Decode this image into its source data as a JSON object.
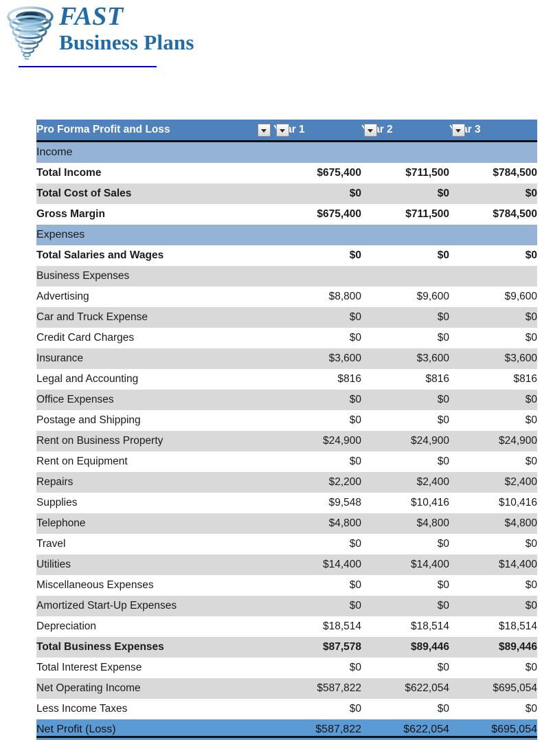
{
  "brand": {
    "line1": "FAST",
    "line2": "Business Plans",
    "logo_icon": "tornado-icon",
    "rule_color": "#0000CC",
    "text_color": "#1F6CA8"
  },
  "table": {
    "columns": [
      {
        "label": "Pro Forma Profit and Loss",
        "filter_icon": "chevron-down-icon"
      },
      {
        "label": "Year 1",
        "filter_icon": "chevron-down-icon"
      },
      {
        "label": "Year 2",
        "filter_icon": "chevron-down-icon"
      },
      {
        "label": "Year 3",
        "filter_icon": "chevron-down-icon"
      }
    ],
    "colors": {
      "header": "#4F81BD",
      "section": "#95B3D7",
      "band_gray": "#D9D9D9",
      "band_white": "#FFFFFF",
      "total": "#5B9BD5"
    },
    "rows": [
      {
        "label": "Income",
        "year1": "",
        "year2": "",
        "year3": "",
        "style": "section",
        "indent": 0,
        "bold": false
      },
      {
        "label": "Total Income",
        "year1": "$675,400",
        "year2": "$711,500",
        "year3": "$784,500",
        "style": "band-white",
        "indent": 1,
        "bold": true
      },
      {
        "label": "Total Cost of Sales",
        "year1": "$0",
        "year2": "$0",
        "year3": "$0",
        "style": "band-gray",
        "indent": 1,
        "bold": true
      },
      {
        "label": "Gross Margin",
        "year1": "$675,400",
        "year2": "$711,500",
        "year3": "$784,500",
        "style": "band-white",
        "indent": 1,
        "bold": true
      },
      {
        "label": "Expenses",
        "year1": "",
        "year2": "",
        "year3": "",
        "style": "section",
        "indent": 0,
        "bold": false
      },
      {
        "label": "Total Salaries and Wages",
        "year1": "$0",
        "year2": "$0",
        "year3": "$0",
        "style": "band-white",
        "indent": 1,
        "bold": true
      },
      {
        "label": "Business Expenses",
        "year1": "",
        "year2": "",
        "year3": "",
        "style": "band-gray",
        "indent": 1,
        "bold": false
      },
      {
        "label": "Advertising",
        "year1": "$8,800",
        "year2": "$9,600",
        "year3": "$9,600",
        "style": "band-white",
        "indent": 2,
        "bold": false
      },
      {
        "label": "Car and Truck Expense",
        "year1": "$0",
        "year2": "$0",
        "year3": "$0",
        "style": "band-gray",
        "indent": 2,
        "bold": false
      },
      {
        "label": "Credit Card Charges",
        "year1": "$0",
        "year2": "$0",
        "year3": "$0",
        "style": "band-white",
        "indent": 2,
        "bold": false
      },
      {
        "label": "Insurance",
        "year1": "$3,600",
        "year2": "$3,600",
        "year3": "$3,600",
        "style": "band-gray",
        "indent": 2,
        "bold": false
      },
      {
        "label": "Legal and Accounting",
        "year1": "$816",
        "year2": "$816",
        "year3": "$816",
        "style": "band-white",
        "indent": 2,
        "bold": false
      },
      {
        "label": "Office Expenses",
        "year1": "$0",
        "year2": "$0",
        "year3": "$0",
        "style": "band-gray",
        "indent": 2,
        "bold": false
      },
      {
        "label": "Postage and Shipping",
        "year1": "$0",
        "year2": "$0",
        "year3": "$0",
        "style": "band-white",
        "indent": 2,
        "bold": false
      },
      {
        "label": "Rent on Business Property",
        "year1": "$24,900",
        "year2": "$24,900",
        "year3": "$24,900",
        "style": "band-gray",
        "indent": 2,
        "bold": false
      },
      {
        "label": "Rent on Equipment",
        "year1": "$0",
        "year2": "$0",
        "year3": "$0",
        "style": "band-white",
        "indent": 2,
        "bold": false
      },
      {
        "label": "Repairs",
        "year1": "$2,200",
        "year2": "$2,400",
        "year3": "$2,400",
        "style": "band-gray",
        "indent": 2,
        "bold": false
      },
      {
        "label": "Supplies",
        "year1": "$9,548",
        "year2": "$10,416",
        "year3": "$10,416",
        "style": "band-white",
        "indent": 2,
        "bold": false
      },
      {
        "label": "Telephone",
        "year1": "$4,800",
        "year2": "$4,800",
        "year3": "$4,800",
        "style": "band-gray",
        "indent": 2,
        "bold": false
      },
      {
        "label": "Travel",
        "year1": "$0",
        "year2": "$0",
        "year3": "$0",
        "style": "band-white",
        "indent": 2,
        "bold": false
      },
      {
        "label": "Utilities",
        "year1": "$14,400",
        "year2": "$14,400",
        "year3": "$14,400",
        "style": "band-gray",
        "indent": 2,
        "bold": false
      },
      {
        "label": "Miscellaneous Expenses",
        "year1": "$0",
        "year2": "$0",
        "year3": "$0",
        "style": "band-white",
        "indent": 2,
        "bold": false
      },
      {
        "label": "Amortized Start-Up Expenses",
        "year1": "$0",
        "year2": "$0",
        "year3": "$0",
        "style": "band-gray",
        "indent": 1,
        "bold": false
      },
      {
        "label": "Depreciation",
        "year1": "$18,514",
        "year2": "$18,514",
        "year3": "$18,514",
        "style": "band-white",
        "indent": 2,
        "bold": false
      },
      {
        "label": "Total Business Expenses",
        "year1": "$87,578",
        "year2": "$89,446",
        "year3": "$89,446",
        "style": "band-gray",
        "indent": 1,
        "bold": true
      },
      {
        "label": "Total Interest Expense",
        "year1": "$0",
        "year2": "$0",
        "year3": "$0",
        "style": "band-white",
        "indent": 1,
        "bold": false
      },
      {
        "label": "Net Operating Income",
        "year1": "$587,822",
        "year2": "$622,054",
        "year3": "$695,054",
        "style": "band-gray",
        "indent": 1,
        "bold": false
      },
      {
        "label": "Less Income Taxes",
        "year1": "$0",
        "year2": "$0",
        "year3": "$0",
        "style": "band-white",
        "indent": 1,
        "bold": false
      },
      {
        "label": "Net Profit (Loss)",
        "year1": "$587,822",
        "year2": "$622,054",
        "year3": "$695,054",
        "style": "total-row",
        "indent": 0,
        "bold": false
      }
    ]
  }
}
